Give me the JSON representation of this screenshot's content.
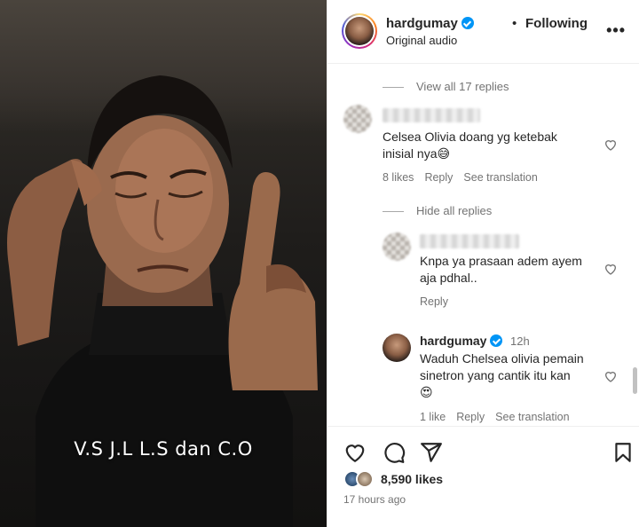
{
  "video": {
    "caption": "V.S J.L L.S dan C.O"
  },
  "post": {
    "username": "hardgumay",
    "separator": "•",
    "follow_status": "Following",
    "audio": "Original audio",
    "more_icon": "more-horizontal-icon"
  },
  "comments": {
    "view_all": "View all 17 replies",
    "hide_all": "Hide all replies",
    "items": [
      {
        "text_line1": "Celsea Olivia doang yg ketebak",
        "text_line2": "inisial nya😅",
        "likes": "8 likes",
        "reply": "Reply",
        "translate": "See translation"
      },
      {
        "text_line1": "Knpa ya prasaan adem ayem",
        "text_line2": "aja pdhal..",
        "reply": "Reply"
      },
      {
        "username": "hardgumay",
        "time": "12h",
        "text_line1": "Waduh Chelsea olivia pemain",
        "text_line2": "sinetron yang cantik itu kan",
        "text_line3": "😍",
        "likes": "1 like",
        "reply": "Reply",
        "translate": "See translation"
      }
    ]
  },
  "footer": {
    "likes": "8,590 likes",
    "time_ago": "17 hours ago"
  },
  "colors": {
    "verified": "#0095f6",
    "muted": "#737373",
    "text": "#262626"
  }
}
